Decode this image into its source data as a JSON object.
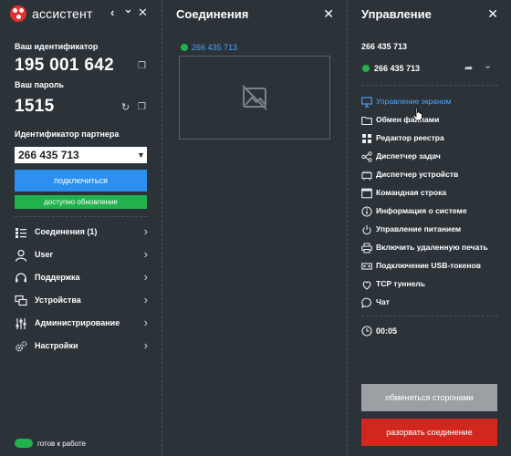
{
  "app": {
    "title": "ассистент",
    "brand_color": "#e0322b",
    "controls": {
      "back": "‹",
      "collapse": "⌄",
      "close": "✕"
    }
  },
  "left": {
    "id_label": "Ваш идентификатор",
    "id_value": "195 001 642",
    "password_label": "Ваш пароль",
    "password_value": "1515",
    "partner_label": "Идентификатор партнера",
    "partner_value": "266 435 713",
    "connect_button": "подключиться",
    "update_notice": "доступно обновление",
    "nav": [
      {
        "label": "Соединения (1)",
        "icon": "connections-icon"
      },
      {
        "label": "User",
        "icon": "user-icon"
      },
      {
        "label": "Поддержка",
        "icon": "headset-icon"
      },
      {
        "label": "Устройства",
        "icon": "devices-icon"
      },
      {
        "label": "Администрирование",
        "icon": "sliders-icon"
      },
      {
        "label": "Настройки",
        "icon": "gear-icon"
      }
    ],
    "status": "готов к работе"
  },
  "middle": {
    "title": "Соединения",
    "close": "✕",
    "session_id": "266 435 713"
  },
  "right": {
    "title": "Управление",
    "close": "✕",
    "remote_id": "266 435 713",
    "remote_id_status": "266 435 713",
    "actions": [
      {
        "label": "Управление экраном",
        "icon": "monitor-icon",
        "active": true
      },
      {
        "label": "Обмен файлами",
        "icon": "folder-icon"
      },
      {
        "label": "Редактор реестра",
        "icon": "registry-icon"
      },
      {
        "label": "Диспетчер задач",
        "icon": "tasks-icon"
      },
      {
        "label": "Диспетчер устройств",
        "icon": "device-manager-icon"
      },
      {
        "label": "Командная строка",
        "icon": "terminal-icon"
      },
      {
        "label": "Информация о системе",
        "icon": "info-icon"
      },
      {
        "label": "Управление питанием",
        "icon": "power-icon"
      },
      {
        "label": "Включить удаленную печать",
        "icon": "printer-icon"
      },
      {
        "label": "Подключение USB-токенов",
        "icon": "usb-icon"
      },
      {
        "label": "TCP туннель",
        "icon": "tunnel-icon"
      },
      {
        "label": "Чат",
        "icon": "chat-icon"
      }
    ],
    "timer": "00:05",
    "swap_button": "обменяться сторонами",
    "disconnect_button": "разорвать соединение"
  },
  "colors": {
    "background": "#2b3238",
    "accent_blue": "#2d8ff0",
    "link_blue": "#4aa3ff",
    "success_green": "#22b14c",
    "danger_red": "#d0281f",
    "disabled_gray": "#9ca0a4"
  }
}
